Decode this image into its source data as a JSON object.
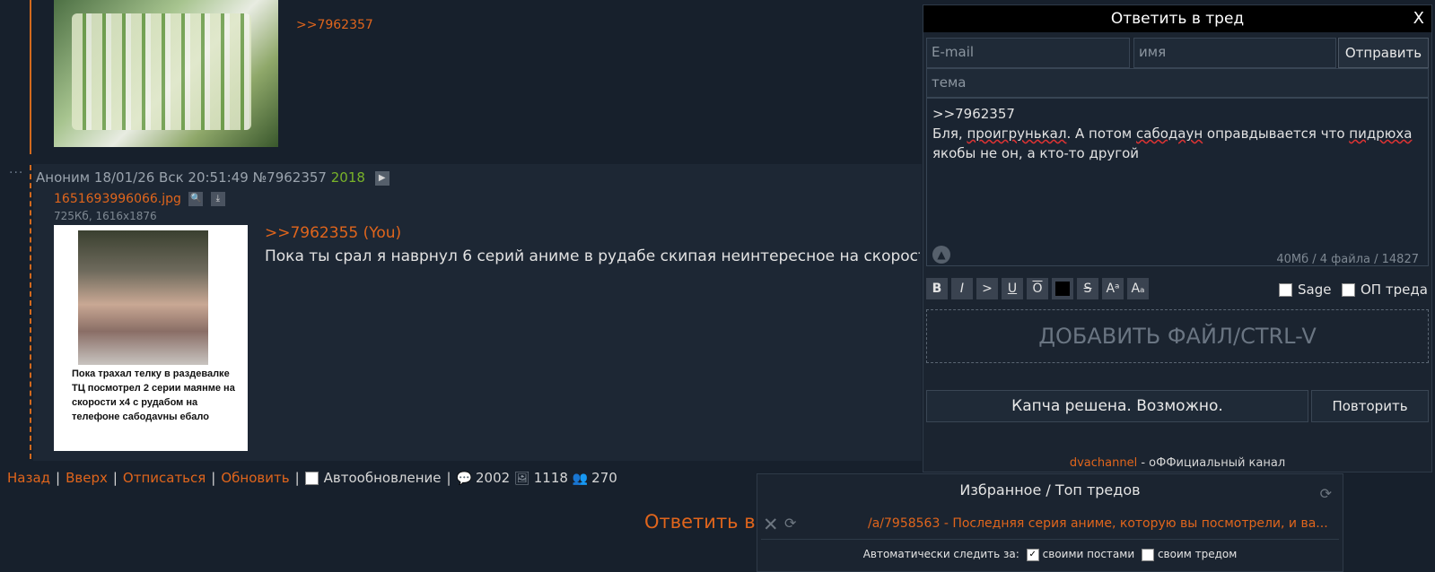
{
  "prev_post": {
    "reply_link": ">>7962357"
  },
  "post": {
    "author": "Аноним",
    "date": "18/01/26 Вск 20:51:49",
    "number": "№7962357",
    "post_count": "2018",
    "file_name": "1651693996066.jpg",
    "file_meta": "725Кб, 1616x1876",
    "thumb_caption": "Пока трахал телку в раздевалке ТЦ посмотрел 2 серии маянме на скорости x4 с рудабом на телефоне сабодаvны ебало",
    "reply_link": ">>7962355 (You)",
    "text": "Пока ты срал я наврнул 6 серий аниме в рудабе скипая неинтересное на скорости х"
  },
  "bottom_nav": {
    "back": "Назад",
    "up": "Вверх",
    "unsubscribe": "Отписаться",
    "refresh": "Обновить",
    "autorefresh": "Автообновление",
    "posts_count": "2002",
    "images_count": "1118",
    "users_count": "270"
  },
  "reply_thread_big": "Ответить в т",
  "reply_form": {
    "title": "Ответить в тред",
    "close": "X",
    "email_placeholder": "E-mail",
    "name_placeholder": "имя",
    "send": "Отправить",
    "subject_placeholder": "тема",
    "message_line1": ">>7962357",
    "message_line2_a": "Бля, ",
    "message_line2_b": "проигрунькал",
    "message_line2_c": ". А потом ",
    "message_line2_d": "сабодаун",
    "message_line2_e": " оправдывается что ",
    "message_line2_f": "пидрюха",
    "message_line3": "якобы не он, а кто-то другой",
    "counter": "40Мб / 4 файла / 14827",
    "fmt_buttons": [
      "B",
      "I",
      ">",
      "U",
      "O",
      "",
      "S",
      "Aᵃ",
      "Aₐ"
    ],
    "sage": "Sage",
    "op": "ОП треда",
    "drop_zone": "ДОБАВИТЬ ФАЙЛ/CTRL-V",
    "captcha": "Капча решена. Возможно.",
    "retry": "Повторить",
    "channel_link": "dvachannel",
    "channel_text": " - оФФициальный канал"
  },
  "favorites": {
    "title": "Избранное / Топ тредов",
    "item": "/a/7958563 - Последняя серия аниме, которую вы посмотрели, и ва...",
    "auto_label": "Автоматически следить за:",
    "own_posts": "своими постами",
    "own_thread": "своим тредом"
  },
  "colors": {
    "accent": "#e0651c",
    "background": "#17202c",
    "count_green": "#79b329"
  }
}
